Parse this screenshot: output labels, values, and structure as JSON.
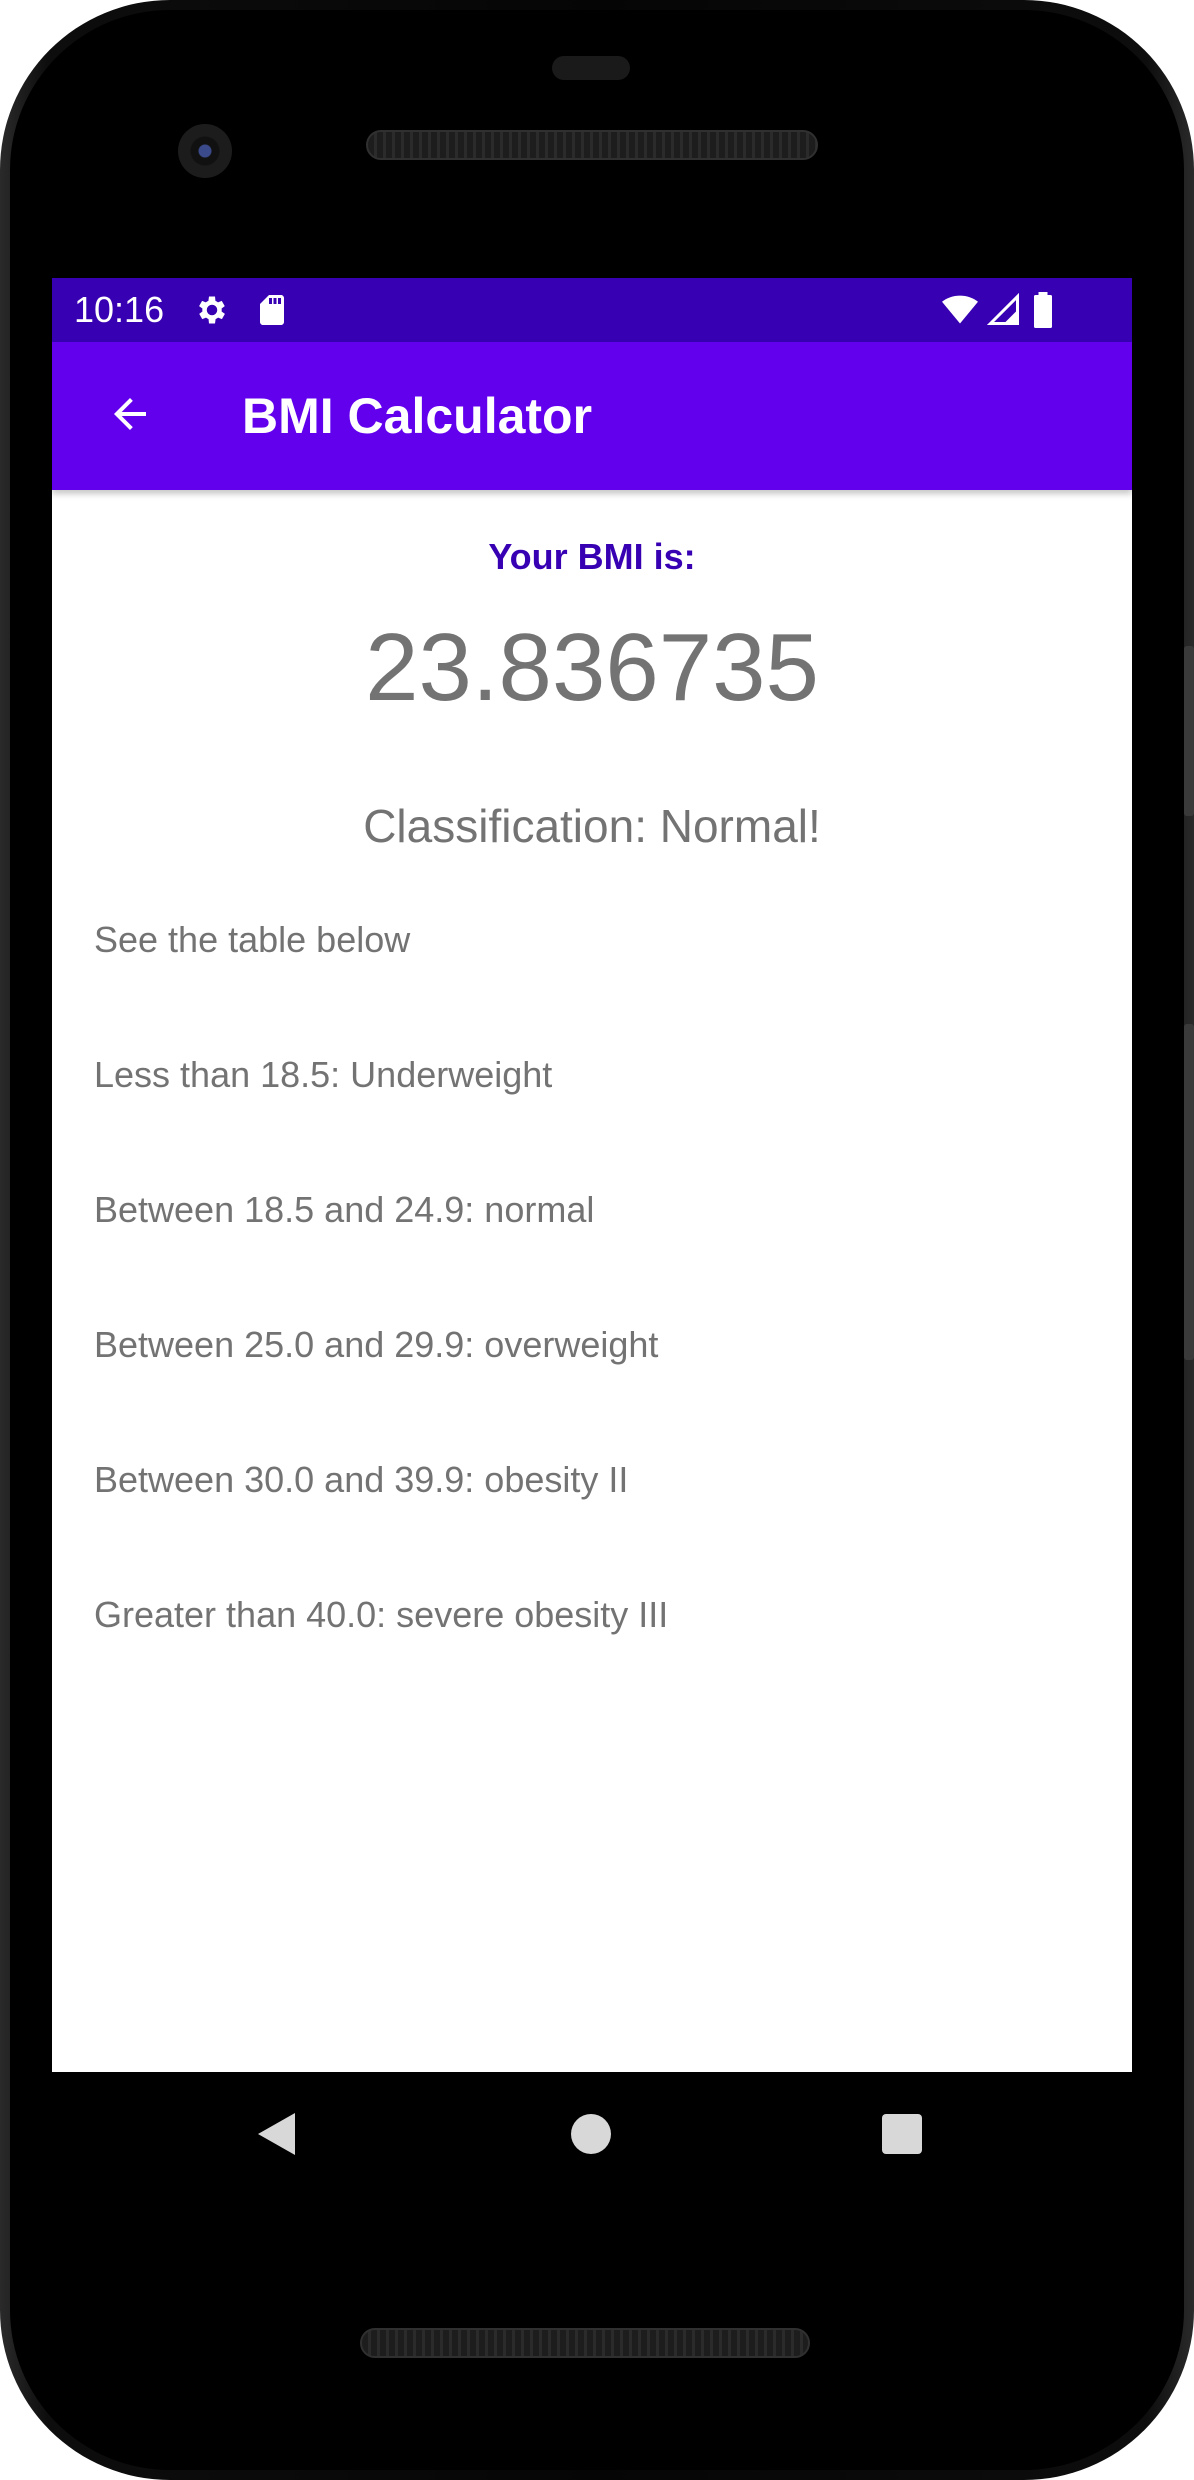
{
  "status_bar": {
    "time": "10:16",
    "left_icons": [
      "gear-icon",
      "sd-card-icon"
    ],
    "right_icons": [
      "wifi-icon",
      "signal-icon",
      "battery-icon"
    ],
    "color": "#3700b3"
  },
  "app_bar": {
    "title": "BMI Calculator",
    "back_icon": "arrow-back-icon",
    "color": "#6200ee"
  },
  "result": {
    "label": "Your BMI is:",
    "value": "23.836735",
    "classification": "Classification: Normal!",
    "label_color": "#3700b3",
    "text_color": "#737373"
  },
  "table": {
    "intro": "See the table below",
    "rows": [
      "Less than 18.5: Underweight",
      "Between 18.5 and 24.9: normal",
      "Between 25.0 and 29.9: overweight",
      "Between 30.0 and 39.9: obesity II",
      "Greater than 40.0: severe obesity III"
    ]
  },
  "navigation_bar": {
    "buttons": [
      "back-triangle-icon",
      "home-circle-icon",
      "recents-square-icon"
    ]
  }
}
